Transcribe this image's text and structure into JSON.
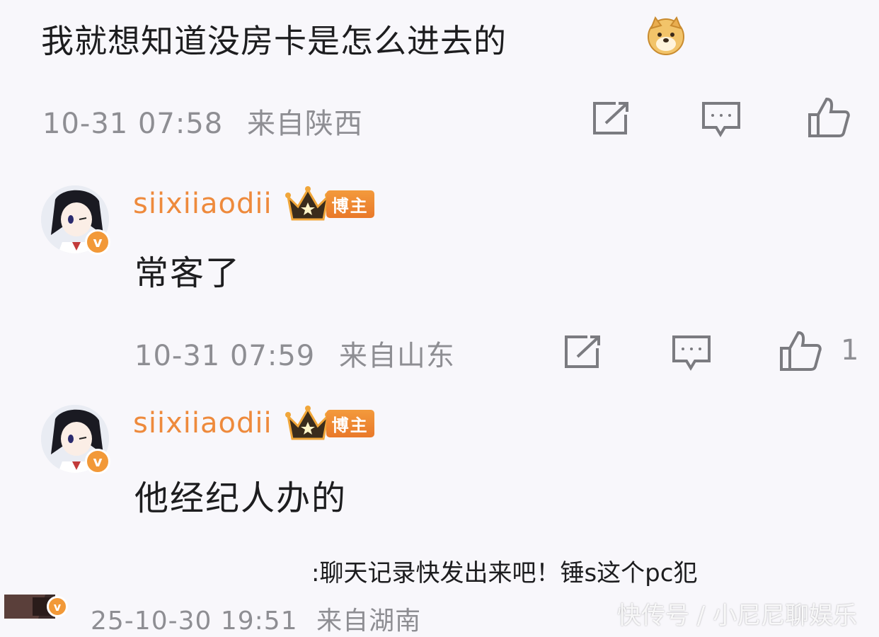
{
  "top_comment": {
    "text": "我就想知道没房卡是怎么进去的",
    "emoji": "doge-emoji",
    "timestamp": "10-31 07:58",
    "location": "来自陕西"
  },
  "replies": [
    {
      "username": "siixiiaodii",
      "badge": "博主",
      "text": "常客了",
      "timestamp": "10-31 07:59",
      "location": "来自山东",
      "like_count": "1"
    },
    {
      "username": "siixiiaodii",
      "badge": "博主",
      "text": "他经纪人办的"
    }
  ],
  "overlay_comment": {
    "text": ":聊天记录快发出来吧！锤s这个pc犯",
    "timestamp": "25-10-30 19:51",
    "location": "来自湖南"
  },
  "watermark": "快传号 / 小尼尼聊娱乐",
  "icons": {
    "share": "share-icon",
    "comment": "comment-icon",
    "like": "thumbs-up-icon",
    "crown": "crown-icon",
    "verified": "verified-icon"
  },
  "colors": {
    "username": "#ee8a3c",
    "meta": "#8e8e93",
    "badge": "#f0913a",
    "text": "#1d1d1f"
  }
}
